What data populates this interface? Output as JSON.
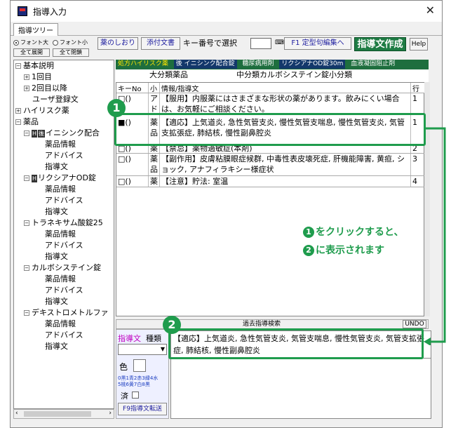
{
  "window": {
    "title": "指導入力",
    "close_glyph": "✕"
  },
  "tab": "指導ツリー",
  "toolbar": {
    "font_large": "フォント大",
    "font_small": "フォント小",
    "expand_all": "全て展開",
    "collapse_all": "全て閉鎖",
    "bookmark": "薬のしおり",
    "attachment": "添付文書",
    "key_select": "キー番号で選択",
    "key_value": "",
    "phrase_edit": "F1 定型句編集へ",
    "create": "指導文作成",
    "help": "Help"
  },
  "tree": {
    "n1": "基本説明",
    "n2": "1回目",
    "n3": "2回目以降",
    "n4": "ユーザ登録文",
    "n5": "ハイリスク薬",
    "n6": "薬品",
    "d1": "イニシンク配合",
    "d1a": "薬品情報",
    "d1b": "アドバイス",
    "d1c": "指導文",
    "d2": "リクシアナOD錠",
    "d2a": "薬品情報",
    "d2b": "アドバイス",
    "d2c": "指導文",
    "d3": "トラネキサム酸錠25",
    "d3a": "薬品情報",
    "d3b": "アドバイス",
    "d3c": "指導文",
    "d4": "カルボシステイン錠",
    "d4a": "薬品情報",
    "d4b": "アドバイス",
    "d4c": "指導文",
    "d5": "デキストロメトルファ",
    "d5a": "薬品情報",
    "d5b": "アドバイス",
    "d5c": "指導文",
    "badge_h": "H",
    "badge_g": "後"
  },
  "infostrip": {
    "c1": "処方ハイリスク薬",
    "c2": "後 イニシンク配合錠",
    "c3": "糖尿病用剤",
    "c4": "リクシアナOD錠30m",
    "c5": "血液凝固阻止剤"
  },
  "category": {
    "major": "大分類薬品",
    "minor": "中分類カルボシステイン錠小分類"
  },
  "grid": {
    "headers": {
      "key": "キーNo",
      "small": "小",
      "text": "情報/指導文",
      "lines": "行"
    },
    "rows": [
      {
        "key": "□()",
        "small": "アド",
        "text": "【服用】内服薬にはさまざまな形状の薬があります。飲みにくい場合は、お気軽にご相談ください。",
        "lines": "1"
      },
      {
        "key": "■()",
        "small": "薬品",
        "text": "【適応】上気道炎, 急性気管支炎, 慢性気管支喘息, 慢性気管支炎, 気管支拡張症, 肺結核, 慢性副鼻腔炎",
        "lines": "1"
      },
      {
        "key": "□()",
        "small": "薬",
        "text": "【禁忌】薬物過敏症(本剤)",
        "lines": "2"
      },
      {
        "key": "□()",
        "small": "薬品",
        "text": "【副作用】皮膚粘膜眼症候群, 中毒性表皮壊死症, 肝機能障害, 黄疸, ショック, アナフィラキシー様症状",
        "lines": "3"
      },
      {
        "key": "□()",
        "small": "薬",
        "text": "【注意】貯法: 室温",
        "lines": "4"
      }
    ]
  },
  "midbar": {
    "past_search": "過去指導検索",
    "undo": "UNDO"
  },
  "leftpane": {
    "label_guidance": "指導文",
    "label_type": "種類",
    "label_color": "色",
    "color_legend1": "0黒1青2赤3緑4水",
    "color_legend2": "5桃6黄7白8黒",
    "label_done": "済",
    "transfer": "F9指導文転送"
  },
  "editor_text": "【適応】上気道炎, 急性気管支炎, 気管支喘息, 慢性気管支炎, 気管支拡張症, 肺結核, 慢性副鼻腔炎",
  "annotation": {
    "num1": "1",
    "num2": "2",
    "line1": "をクリックすると、",
    "line2": "に表示されます"
  },
  "accent": "#1f9c4d"
}
